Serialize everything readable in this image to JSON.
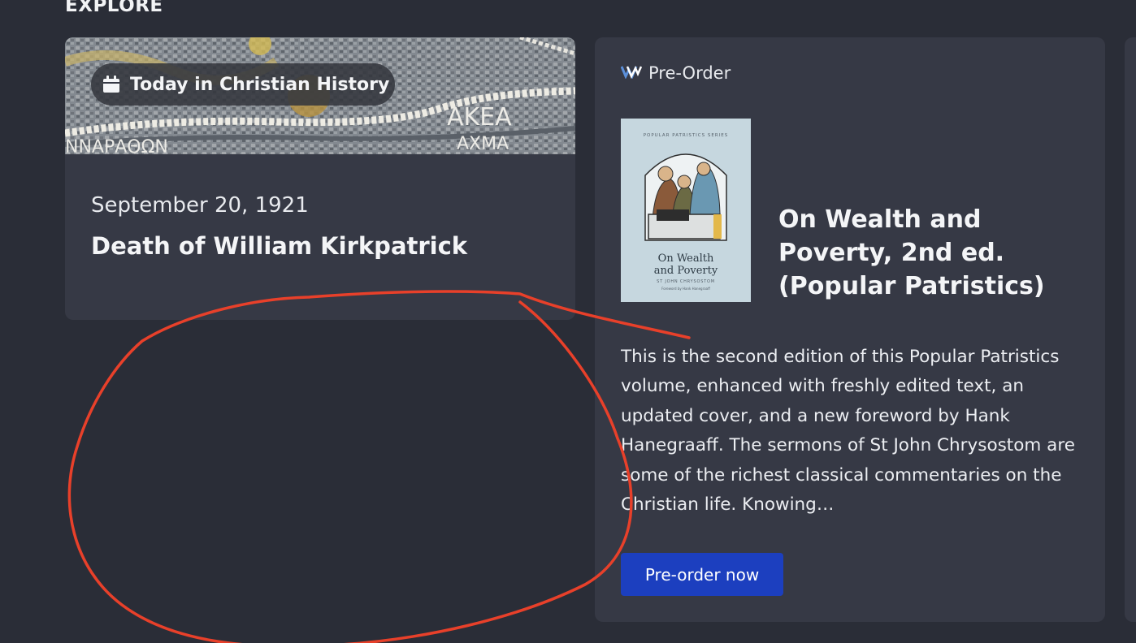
{
  "section": {
    "title": "EXPLORE"
  },
  "history_card": {
    "badge_label": "Today in Christian History",
    "date": "September 20, 1921",
    "event": "Death of William Kirkpatrick",
    "image_text_1": "AKEA",
    "image_text_2": "ΑΧΜΑ",
    "image_text_3": "ΝΝΑΡΑΘΩΝ"
  },
  "preorder_card": {
    "tag_label": "Pre-Order",
    "book_title": "On Wealth and Poverty, 2nd ed. (Popular Patristics)",
    "description": "This is the second edition of this Popular Patristics volume, enhanced with freshly edited text, an updated cover, and a new foreword by Hank Hanegraaff. The sermons of St John Chrysostom are some of the richest classical commentaries on the Christian life. Knowing…",
    "button_label": "Pre-order now",
    "cover": {
      "series": "POPULAR PATRISTICS SERIES",
      "title_line1": "On Wealth",
      "title_line2": "and Poverty",
      "author": "ST JOHN CHRYSOSTOM",
      "foreword": "Foreword by Hank Hanegraaff"
    }
  },
  "colors": {
    "background": "#2a2d37",
    "card": "#363945",
    "button": "#1c3fbf",
    "annotation": "#e8402a"
  }
}
